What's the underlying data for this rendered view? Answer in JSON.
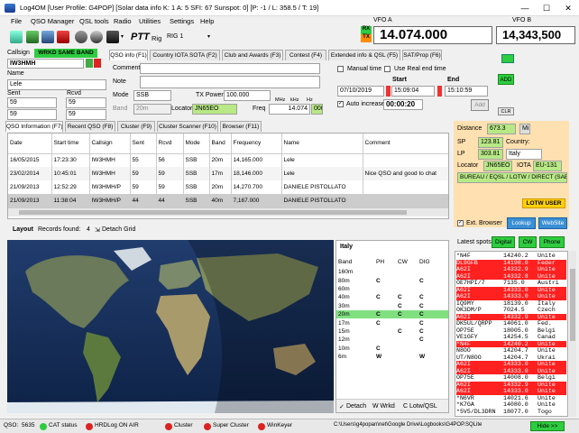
{
  "window": {
    "title": "Log4OM [User Profile: G4POP] [Solar data info K: 1 A: 5 SFI: 67 Sunspot: 0] [P: -1 / L: 358.5 / T: 19]",
    "minimize": "—",
    "maximize": "☐",
    "close": "✕"
  },
  "menu": [
    "File",
    "QSO Manager",
    "QSL tools",
    "Radio",
    "Utilities",
    "Settings",
    "Help"
  ],
  "toolbar": {
    "ptt": "PTT",
    "rig_label": "Rig",
    "rig_value": "RIG 1"
  },
  "vfo": {
    "a_label": "VFO A",
    "a_value": "14.074.000",
    "b_label": "VFO B",
    "b_value": "14,343,500",
    "rx": "RX",
    "tx": "TX"
  },
  "entry": {
    "callsign_label": "Callsign",
    "band_warning": "WRKD SAME BAND",
    "callsign": "IW3HMH",
    "name_label": "Name",
    "name": "Lele",
    "sent_label": "Sent",
    "rcvd_label": "Rcvd",
    "sent": "59",
    "rcvd": "59",
    "sent2": "59",
    "rcvd2": "59"
  },
  "info_tabs": [
    "QSO info (F1)",
    "Country IOTA SOTA (F2)",
    "Club and Awards (F3)",
    "Contest (F4)",
    "Extended info & QSL (F5)",
    "SAT/Prop (F6)"
  ],
  "qso_info": {
    "comment_label": "Comment",
    "note_label": "Note",
    "mode_label": "Mode",
    "mode": "SSB",
    "txpower_label": "TX Power",
    "txpower": "100.000",
    "band_label": "Band",
    "band": "20m",
    "locator_label": "Locator",
    "locator": "JN65EO",
    "freq_label": "Freq",
    "mhz_label": "MHz",
    "khz_label": "kHz",
    "hz_label": "Hz",
    "freq": "14.074",
    "freq_hz": "000",
    "manual_time": "Manual time",
    "use_real_end": "Use Real end time",
    "start_label": "Start",
    "end_label": "End",
    "date": "07/10/2019",
    "start_time": "15:09:04",
    "end_time": "15:10:59",
    "auto_increase": "Auto increase",
    "duration": "00:00:20",
    "add_button": "Add",
    "add_green": "ADD",
    "clr": "CLR"
  },
  "lower_tabs": [
    "QSO Information (F7)",
    "Recent QSO (F8)",
    "Cluster (F9)",
    "Cluster Scanner (F10)",
    "Browser (F11)"
  ],
  "log_table": {
    "headers": [
      "Date",
      "Start time",
      "Callsign",
      "Sent",
      "Rcvd",
      "Mode",
      "Band",
      "Frequency",
      "Name",
      "Comment"
    ],
    "rows": [
      [
        "16/05/2015",
        "17:23:30",
        "IW3HMH",
        "55",
        "56",
        "SSB",
        "20m",
        "14,165.000",
        "Lele",
        ""
      ],
      [
        "23/02/2014",
        "10:45:01",
        "IW3HMH",
        "59",
        "59",
        "SSB",
        "17m",
        "18,146.000",
        "Lele",
        "Nice QSO and good to chat"
      ],
      [
        "21/09/2013",
        "12:52:29",
        "IW3HMH/P",
        "59",
        "59",
        "SSB",
        "20m",
        "14,270.700",
        "DANIELE PISTOLLATO",
        ""
      ],
      [
        "21/09/2013",
        "11:38:04",
        "IW3HMH/P",
        "44",
        "44",
        "SSB",
        "40m",
        "7,167.000",
        "DANIELE PISTOLLATO",
        ""
      ]
    ]
  },
  "layout_bar": {
    "layout": "Layout",
    "records": "Records found:",
    "count": "4",
    "detach": "Detach Grid"
  },
  "grid": {
    "country": "Italy",
    "headers": [
      "Band",
      "PH",
      "CW",
      "DIG"
    ],
    "rows": [
      [
        "160m",
        "",
        "",
        ""
      ],
      [
        "80m",
        "C",
        "",
        "C"
      ],
      [
        "60m",
        "",
        "",
        ""
      ],
      [
        "40m",
        "C",
        "C",
        "C"
      ],
      [
        "30m",
        "",
        "C",
        "C"
      ],
      [
        "20m",
        "C",
        "C",
        "C"
      ],
      [
        "17m",
        "C",
        "",
        "C"
      ],
      [
        "15m",
        "",
        "C",
        "C"
      ],
      [
        "12m",
        "",
        "",
        "C"
      ],
      [
        "10m",
        "C",
        "",
        ""
      ],
      [
        "6m",
        "W",
        "",
        "W"
      ]
    ],
    "footer_detach": "Detach",
    "footer_wrkd": "W Wrkd",
    "footer_cl": "C Lotw/QSL"
  },
  "side": {
    "distance_label": "Distance",
    "distance": "673.3",
    "unit": "Mi",
    "sp_label": "SP",
    "sp": "123.81",
    "country_label": "Country:",
    "country": "Italy",
    "lp_label": "LP",
    "lp": "303.81",
    "locator_label": "Locator",
    "locator": "JN65EO",
    "iota_label": "IOTA",
    "iota": "EU-131",
    "qsl_info": "BUREAU / EQSL / LOTW / DIRECT (SAE",
    "lotw_user": "LOTW USER",
    "ext_browser": "Ext. Browser",
    "lookup": "Lookup",
    "website": "WebSite",
    "latest_spots": "Latest spots",
    "digital": "Digital",
    "cw": "CW",
    "phone": "Phone"
  },
  "spots": [
    {
      "call": "*N4F",
      "freq": "14240.2",
      "cty": "Unite",
      "hl": ""
    },
    {
      "call": "DL9GFB",
      "freq": "14198.0",
      "cty": "Feder",
      "hl": "red"
    },
    {
      "call": "A62I",
      "freq": "14332.9",
      "cty": "Unite",
      "hl": "red"
    },
    {
      "call": "A62I",
      "freq": "14332.8",
      "cty": "Unite",
      "hl": "red"
    },
    {
      "call": "OE7HPI/7",
      "freq": "7135.0",
      "cty": "Austri",
      "hl": ""
    },
    {
      "call": "A62I",
      "freq": "14333.0",
      "cty": "Unite",
      "hl": "red"
    },
    {
      "call": "A62I",
      "freq": "14333.0",
      "cty": "Unite",
      "hl": "red"
    },
    {
      "call": "IQ9MY",
      "freq": "18139.0",
      "cty": "Italy",
      "hl": ""
    },
    {
      "call": "OK3DM/P",
      "freq": "7024.5",
      "cty": "Czech",
      "hl": ""
    },
    {
      "call": "A62I",
      "freq": "14332.9",
      "cty": "Unite",
      "hl": "red"
    },
    {
      "call": "DK5UL/QRPP",
      "freq": "14061.0",
      "cty": "Fed.",
      "hl": ""
    },
    {
      "call": "OP75E",
      "freq": "18005.0",
      "cty": "Belgi",
      "hl": ""
    },
    {
      "call": "VE1GFY",
      "freq": "14254.5",
      "cty": "Canad",
      "hl": ""
    },
    {
      "call": "*N4F",
      "freq": "14240.2",
      "cty": "Unite",
      "hl": "red"
    },
    {
      "call": "N8OO",
      "freq": "14204.7",
      "cty": "Unite",
      "hl": ""
    },
    {
      "call": "UT/N8OO",
      "freq": "14204.7",
      "cty": "Ukrai",
      "hl": ""
    },
    {
      "call": "A62I",
      "freq": "14333.0",
      "cty": "Unite",
      "hl": "red"
    },
    {
      "call": "A62I",
      "freq": "14333.0",
      "cty": "Unite",
      "hl": "red"
    },
    {
      "call": "OP75E",
      "freq": "14008.0",
      "cty": "Belgi",
      "hl": ""
    },
    {
      "call": "A62I",
      "freq": "14332.9",
      "cty": "Unite",
      "hl": "red"
    },
    {
      "call": "A62I",
      "freq": "14333.0",
      "cty": "Unite",
      "hl": "red"
    },
    {
      "call": "*N6VR",
      "freq": "14021.6",
      "cty": "Unite",
      "hl": ""
    },
    {
      "call": "*K7GA",
      "freq": "14080.0",
      "cty": "Unite",
      "hl": ""
    },
    {
      "call": "*5V5/DL3DRN",
      "freq": "18077.0",
      "cty": "Togo",
      "hl": ""
    }
  ],
  "status": {
    "qso_label": "QSO:",
    "qso_count": "5635",
    "cat": "CAT status",
    "hrdlog": "HRDLog ON AIR",
    "cluster": "Cluster",
    "super": "Super Cluster",
    "winkeyer": "WinKeyer",
    "path": "C:\\Users\\g4popan\\net\\Google Drive\\Logbooks\\G4POP.SQLite",
    "hide": "Hide >>"
  },
  "colors": {
    "accent_green": "#2ecc40",
    "field_green": "#b8e986",
    "spot_red": "#ff2020",
    "row_highlight": "#80e080",
    "header_blue": "#cfe0f5"
  }
}
